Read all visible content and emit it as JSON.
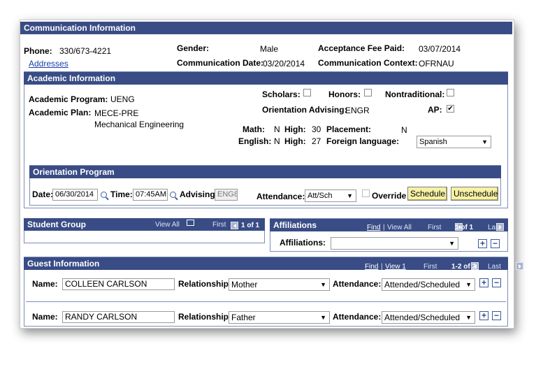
{
  "communication": {
    "title": "Communication Information",
    "phone_label": "Phone:",
    "phone_value": "330/673-4221",
    "addresses_link": "Addresses",
    "gender_label": "Gender:",
    "gender_value": "Male",
    "acceptance_fee_label": "Acceptance Fee Paid:",
    "acceptance_fee_value": "03/07/2014",
    "comm_date_label": "Communication Date:",
    "comm_date_value": "03/20/2014",
    "comm_context_label": "Communication Context:",
    "comm_context_value": "OFRNAU"
  },
  "academic": {
    "title": "Academic Information",
    "program_label": "Academic Program:",
    "program_value": "UENG",
    "plan_label": "Academic Plan:",
    "plan_value": "MECE-PRE",
    "plan_desc": "Mechanical Engineering",
    "scholars_label": "Scholars:",
    "scholars_checked": false,
    "honors_label": "Honors:",
    "honors_checked": false,
    "nontraditional_label": "Nontraditional:",
    "nontraditional_checked": false,
    "orientation_advising_label": "Orientation Advising:",
    "orientation_advising_value": "ENGR",
    "ap_label": "AP:",
    "ap_checked": true,
    "math_label": "Math:",
    "math_value": "N",
    "math_high_label": "High:",
    "math_high_value": "30",
    "placement_label": "Placement:",
    "placement_value": "N",
    "english_label": "English:",
    "english_value": "N",
    "english_high_label": "High:",
    "english_high_value": "27",
    "foreign_language_label": "Foreign language:",
    "foreign_language_value": "Spanish"
  },
  "orientation": {
    "title": "Orientation Program",
    "date_label": "Date:",
    "date_value": "06/30/2014",
    "time_label": "Time:",
    "time_value": "07:45AM",
    "advising_label": "Advising:",
    "advising_value": "ENG8",
    "attendance_label": "Attendance:",
    "attendance_value": "Att/Sch",
    "override_label": "Override",
    "override_checked": false,
    "schedule_button": "Schedule",
    "unschedule_button": "Unschedule"
  },
  "student_group": {
    "title": "Student Group",
    "view_all": "View All",
    "first": "First",
    "count": "1 of 1"
  },
  "affiliations": {
    "title": "Affiliations",
    "find": "Find",
    "sep": "|",
    "view_all": "View All",
    "first": "First",
    "count": "1 of 1",
    "last": "Last",
    "field_label": "Affiliations:",
    "field_value": ""
  },
  "guest": {
    "title": "Guest Information",
    "find": "Find",
    "sep": "|",
    "view_one": "View 1",
    "first": "First",
    "count": "1-2 of 2",
    "last": "Last",
    "rows": [
      {
        "name_label": "Name:",
        "name": "COLLEEN CARLSON",
        "relationship_label": "Relationship:",
        "relationship": "Mother",
        "attendance_label": "Attendance:",
        "attendance": "Attended/Scheduled"
      },
      {
        "name_label": "Name:",
        "name": "RANDY CARLSON",
        "relationship_label": "Relationship:",
        "relationship": "Father",
        "attendance_label": "Attendance:",
        "attendance": "Attended/Scheduled"
      }
    ]
  },
  "colors": {
    "header_bg": "#394c85",
    "button_bg": "#f6f1a6",
    "link": "#1a3fa8"
  }
}
